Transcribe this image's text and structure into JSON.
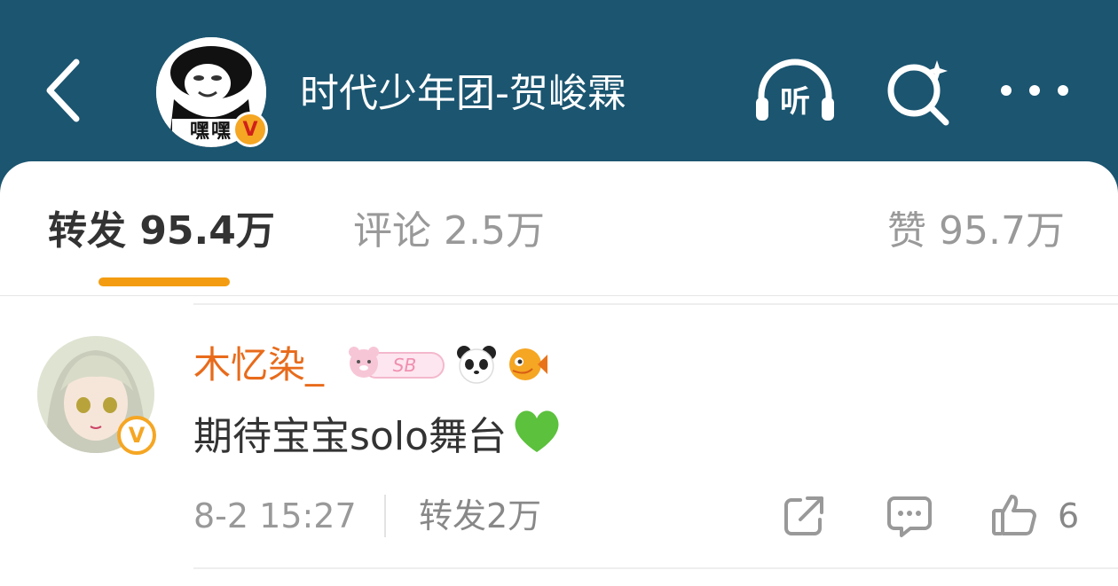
{
  "header": {
    "title": "时代少年团-贺峻霖",
    "avatar_caption": "嘿嘿",
    "verified_mark": "V",
    "icons": {
      "back": "chevron-left-icon",
      "listen": "headphones-listen-icon",
      "listen_label": "听",
      "search": "search-sparkle-icon",
      "more": "more-dots-icon"
    }
  },
  "tabs": [
    {
      "label": "转发 95.4万",
      "active": true
    },
    {
      "label": "评论 2.5万",
      "active": false
    },
    {
      "label": "赞 95.7万",
      "active": false
    }
  ],
  "comment": {
    "username": "木忆染_",
    "badges": [
      "bear-sb-badge",
      "panda-badge",
      "fish-badge"
    ],
    "badge_text": "SB",
    "verified_mark": "V",
    "text": "期待宝宝solo舞台",
    "emoji": "green-heart",
    "time": "8-2 15:27",
    "repost_text": "转发2万",
    "like_count": "6"
  },
  "colors": {
    "header_bg": "#1b5570",
    "accent_orange": "#f39c11",
    "username": "#e86b1b",
    "verified_badge": "#f5a623",
    "heart": "#5cc13d"
  }
}
